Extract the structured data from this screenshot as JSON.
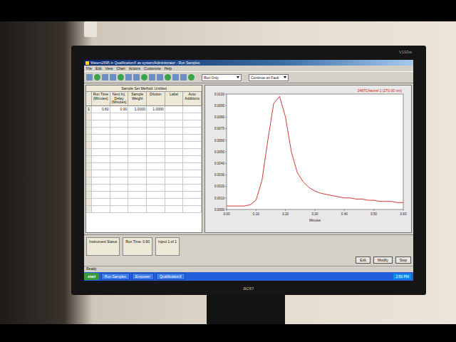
{
  "window": {
    "title": "Waters2695 in QualificationX as system/Administrator - Run Samples"
  },
  "monitor": {
    "brand": "acer",
    "model": "V193w"
  },
  "menu": [
    "File",
    "Edit",
    "View",
    "Chart",
    "Actions",
    "Customize",
    "Help"
  ],
  "toolbar": {
    "run_mode": "Run Only",
    "fault_mode": "Continue on Fault"
  },
  "table": {
    "title": "Sample Set Method: Untitled",
    "columns": [
      "",
      "Run Time (Minutes)",
      "Next Inj. Delay (Minutes)",
      "Sample Weight",
      "Dilution",
      "Label",
      "Auto Additions"
    ],
    "rows": [
      [
        "1",
        "0.60",
        "0.00",
        "1.0000",
        "1.0000",
        "",
        ""
      ],
      [
        "",
        "",
        "",
        "",
        "",
        "",
        ""
      ],
      [
        "",
        "",
        "",
        "",
        "",
        "",
        ""
      ],
      [
        "",
        "",
        "",
        "",
        "",
        "",
        ""
      ],
      [
        "",
        "",
        "",
        "",
        "",
        "",
        ""
      ],
      [
        "",
        "",
        "",
        "",
        "",
        "",
        ""
      ],
      [
        "",
        "",
        "",
        "",
        "",
        "",
        ""
      ],
      [
        "",
        "",
        "",
        "",
        "",
        "",
        ""
      ],
      [
        "",
        "",
        "",
        "",
        "",
        "",
        ""
      ],
      [
        "",
        "",
        "",
        "",
        "",
        "",
        ""
      ],
      [
        "",
        "",
        "",
        "",
        "",
        "",
        ""
      ],
      [
        "",
        "",
        "",
        "",
        "",
        "",
        ""
      ],
      [
        "",
        "",
        "",
        "",
        "",
        "",
        ""
      ],
      [
        "",
        "",
        "",
        "",
        "",
        "",
        ""
      ],
      [
        "",
        "",
        "",
        "",
        "",
        "",
        ""
      ]
    ]
  },
  "chart": {
    "legend": "2487Channel 1 (270.00 nm)",
    "x_title": "Minutes",
    "x_ticks": [
      "0.00",
      "0.10",
      "0.20",
      "0.30",
      "0.40",
      "0.50",
      "0.60"
    ],
    "y_ticks": [
      "0.0000",
      "0.0010",
      "0.0020",
      "0.0030",
      "0.0040",
      "0.0050",
      "0.0060",
      "0.0070",
      "0.0080",
      "0.0090",
      "0.0100"
    ],
    "series": [
      {
        "name": "Channel 1",
        "color": "#d02020",
        "x": [
          0.0,
          0.02,
          0.04,
          0.06,
          0.08,
          0.1,
          0.12,
          0.14,
          0.16,
          0.18,
          0.2,
          0.22,
          0.24,
          0.26,
          0.28,
          0.3,
          0.32,
          0.34,
          0.36,
          0.38,
          0.4,
          0.42,
          0.44,
          0.46,
          0.48,
          0.5,
          0.52,
          0.54,
          0.56,
          0.58,
          0.6
        ],
        "y": [
          0.0003,
          0.0003,
          0.0003,
          0.0003,
          0.0004,
          0.0008,
          0.0025,
          0.006,
          0.0092,
          0.0098,
          0.008,
          0.005,
          0.0032,
          0.0024,
          0.0019,
          0.0016,
          0.0014,
          0.0013,
          0.0012,
          0.0011,
          0.001,
          0.001,
          0.0009,
          0.0009,
          0.0008,
          0.0008,
          0.0007,
          0.0007,
          0.0007,
          0.0006,
          0.0006
        ]
      }
    ]
  },
  "bottom_panel": {
    "boxes": [
      "Instrument Status",
      "Run Time: 0.60",
      "Inject 1 of 1"
    ],
    "buttons": [
      "Edit",
      "Modify",
      "Stop"
    ]
  },
  "status_bar": "Ready",
  "taskbar": {
    "start": "start",
    "items": [
      "Run Samples",
      "Empower",
      "QualificationX"
    ],
    "clock": "2:50 PM"
  }
}
